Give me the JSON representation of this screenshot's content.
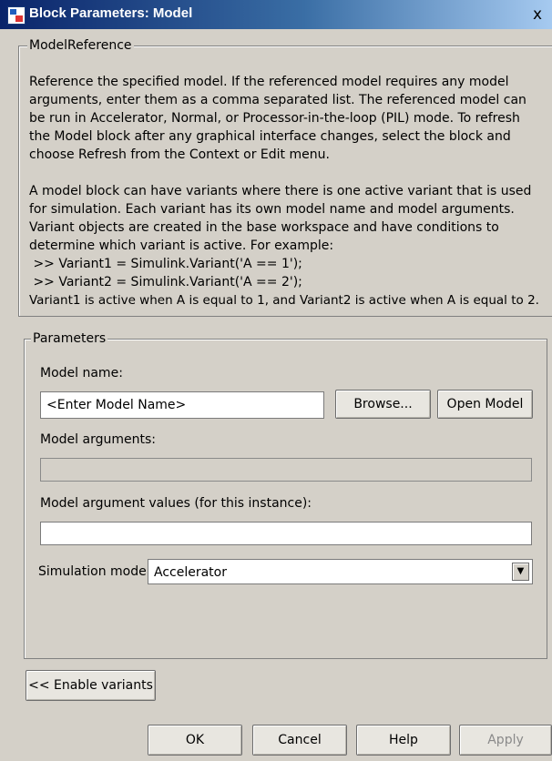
{
  "window": {
    "title": "Block Parameters: Model",
    "close_glyph": "x"
  },
  "model_reference": {
    "legend": "ModelReference",
    "paragraph1": "Reference the specified model.  If the referenced model requires any model arguments, enter them as a comma separated list.  The referenced model can be run in Accelerator, Normal, or Processor-in-the-loop (PIL) mode.  To refresh the Model block after any graphical interface changes, select the block and choose Refresh from the Context or Edit menu.",
    "paragraph2": "A model block can have variants where there is one active variant that is used for simulation. Each variant has its own model name and model arguments. Variant objects are created in the base workspace and have conditions to determine which variant is active. For example:",
    "example1": " >> Variant1 = Simulink.Variant('A == 1');",
    "example2": " >> Variant2 = Simulink.Variant('A == 2');",
    "paragraph3": "Variant1 is active when A is equal to 1, and Variant2 is active when A is equal to 2."
  },
  "parameters": {
    "legend": "Parameters",
    "model_name_label": "Model name:",
    "model_name_value": "<Enter Model Name>",
    "browse_label": "Browse...",
    "open_model_label": "Open Model",
    "model_arguments_label": "Model arguments:",
    "model_arguments_value": "",
    "model_argument_values_label": "Model argument values (for this instance):",
    "model_argument_values_value": "",
    "simulation_mode_label": "Simulation mode:",
    "simulation_mode_value": "Accelerator"
  },
  "enable_variants_label": "<< Enable variants",
  "footer": {
    "ok_label": "OK",
    "cancel_label": "Cancel",
    "help_label": "Help",
    "apply_label": "Apply"
  },
  "icons": {
    "app": "simulink-block-icon",
    "dropdown": "chevron-down-icon"
  }
}
